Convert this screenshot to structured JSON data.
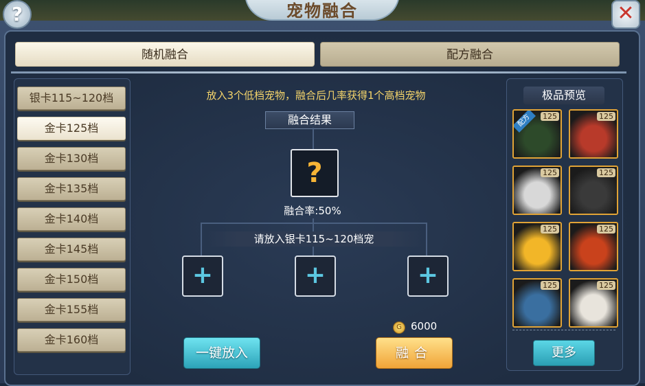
{
  "window": {
    "title": "宠物融合",
    "help_icon": "?",
    "close_icon": "✕"
  },
  "tabs": [
    {
      "label": "随机融合",
      "active": true
    },
    {
      "label": "配方融合",
      "active": false
    }
  ],
  "categories": [
    {
      "label": "银卡115~120档",
      "active": false
    },
    {
      "label": "金卡125档",
      "active": true
    },
    {
      "label": "金卡130档",
      "active": false
    },
    {
      "label": "金卡135档",
      "active": false
    },
    {
      "label": "金卡140档",
      "active": false
    },
    {
      "label": "金卡145档",
      "active": false
    },
    {
      "label": "金卡150档",
      "active": false
    },
    {
      "label": "金卡155档",
      "active": false
    },
    {
      "label": "金卡160档",
      "active": false
    }
  ],
  "fusion": {
    "hint": "放入3个低档宠物，融合后几率获得1个高档宠物",
    "result_label": "融合结果",
    "result_placeholder": "?",
    "rate_text": "融合率:50%",
    "slot_prompt": "请放入银卡115~120档宠",
    "slot_icon": "+",
    "cost": "6000",
    "one_key_button": "一键放入",
    "fuse_button": "融合"
  },
  "preview": {
    "title": "极品预览",
    "recipe_tag": "配方",
    "pets": [
      {
        "level": "125",
        "color": "#2d4a2a",
        "recipe": true
      },
      {
        "level": "125",
        "color": "#b83a2a",
        "recipe": false
      },
      {
        "level": "125",
        "color": "#d8d8d8",
        "recipe": false
      },
      {
        "level": "125",
        "color": "#3a3a3a",
        "recipe": false
      },
      {
        "level": "125",
        "color": "#f2b628",
        "recipe": false
      },
      {
        "level": "125",
        "color": "#c9421c",
        "recipe": false
      },
      {
        "level": "125",
        "color": "#3a6fa0",
        "recipe": false
      },
      {
        "level": "125",
        "color": "#e8e4dc",
        "recipe": false
      }
    ],
    "more_button": "更多"
  }
}
